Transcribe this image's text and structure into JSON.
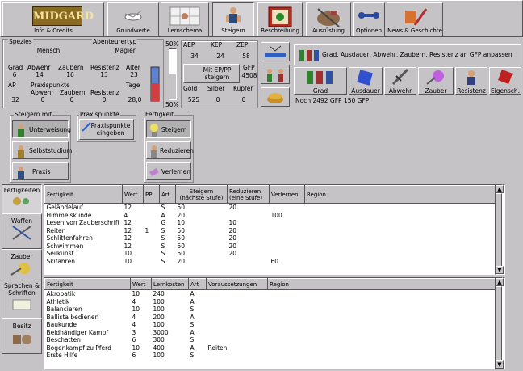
{
  "toolbar": {
    "logo": "MIDGARD",
    "tabs": [
      {
        "label": "Info & Credits"
      },
      {
        "label": "Grundwerte"
      },
      {
        "label": "Lernschema"
      },
      {
        "label": "Steigern"
      },
      {
        "label": "Beschreibung"
      },
      {
        "label": "Ausrüstung"
      },
      {
        "label": "Optionen"
      },
      {
        "label": "News & Geschichte"
      }
    ]
  },
  "character": {
    "spezies_label": "Spezies",
    "spezies": "Mensch",
    "abenteurertyp_label": "Abenteurertyp",
    "abenteurertyp": "Magier",
    "grad_label": "Grad",
    "grad": "6",
    "abwehr_label": "Abwehr",
    "abwehr": "14",
    "zaubern_label": "Zaubern",
    "zaubern": "16",
    "resistenz_label": "Resistenz",
    "resistenz": "13",
    "alter_label": "Alter",
    "alter": "23",
    "ap_label": "AP",
    "ap": "32",
    "praxispunkte_label": "Praxispunkte",
    "pp_abwehr_label": "Abwehr",
    "pp_abwehr": "0",
    "pp_zaubern_label": "Zaubern",
    "pp_zaubern": "0",
    "pp_resistenz_label": "Resistenz",
    "pp_resistenz": "0",
    "tage_label": "Tage",
    "tage": "28,0"
  },
  "progress": {
    "top_label": "50%",
    "bottom_label": "50%"
  },
  "points": {
    "aep_label": "AEP",
    "aep": "34",
    "kep_label": "KEP",
    "kep": "24",
    "zep_label": "ZEP",
    "zep": "58",
    "gfp_label": "GFP",
    "gfp": "4508",
    "gold_label": "Gold",
    "gold": "525",
    "silber_label": "Silber",
    "silber": "0",
    "kupfer_label": "Kupfer",
    "kupfer": "0",
    "mit_ep_button": "Mit EP/PP steigern"
  },
  "anpassen_button": "Grad, Ausdauer, Abwehr, Zaubern, Resistenz an GFP anpassen",
  "steigern_icons": [
    {
      "label": "Grad"
    },
    {
      "label": "Ausdauer"
    },
    {
      "label": "Abwehr"
    },
    {
      "label": "Zauber"
    },
    {
      "label": "Resistenz"
    },
    {
      "label": "Eigensch."
    }
  ],
  "gfp_note": "Noch 2492 GFP    150 GFP",
  "steigern_mit": {
    "title": "Steigern mit",
    "options": [
      {
        "label": "Unterweisung"
      },
      {
        "label": "Selbststudium"
      },
      {
        "label": "Praxis"
      }
    ]
  },
  "praxispunkte_box": {
    "title": "Praxispunkte",
    "button": "Praxispunkte eingeben"
  },
  "fertigkeit_box": {
    "title": "Fertigkeit",
    "options": [
      {
        "label": "Steigern"
      },
      {
        "label": "Reduzieren"
      },
      {
        "label": "Verlernen"
      }
    ]
  },
  "sidebar": [
    {
      "label": "Fertigkeiten"
    },
    {
      "label": "Waffen"
    },
    {
      "label": "Zauber"
    },
    {
      "label": "Sprachen & Schriften"
    },
    {
      "label": "Besitz"
    }
  ],
  "upper_table": {
    "headers": [
      "Fertigkeit",
      "Wert",
      "PP",
      "Art",
      "Steigern (nächste Stufe)",
      "Reduzieren (eine Stufe)",
      "Verlernen",
      "Region"
    ],
    "rows": [
      [
        "Geländelauf",
        "12",
        "",
        "S",
        "50",
        "20",
        "",
        ""
      ],
      [
        "Himmelskunde",
        "4",
        "",
        "A",
        "20",
        "",
        "100",
        ""
      ],
      [
        "Lesen von Zauberschrift",
        "12",
        "",
        "G",
        "10",
        "10",
        "",
        ""
      ],
      [
        "Reiten",
        "12",
        "1",
        "S",
        "50",
        "20",
        "",
        ""
      ],
      [
        "Schlittenfahren",
        "12",
        "",
        "S",
        "50",
        "20",
        "",
        ""
      ],
      [
        "Schwimmen",
        "12",
        "",
        "S",
        "50",
        "20",
        "",
        ""
      ],
      [
        "Seilkunst",
        "10",
        "",
        "S",
        "50",
        "20",
        "",
        ""
      ],
      [
        "Skifahren",
        "10",
        "",
        "S",
        "20",
        "",
        "60",
        ""
      ]
    ]
  },
  "lower_table": {
    "headers": [
      "Fertigkeit",
      "Wert",
      "Lernkosten",
      "Art",
      "Voraussetzungen",
      "Region"
    ],
    "rows": [
      [
        "Akrobatik",
        "10",
        "240",
        "A",
        "",
        ""
      ],
      [
        "Athletik",
        "4",
        "100",
        "A",
        "",
        ""
      ],
      [
        "Balancieren",
        "10",
        "100",
        "S",
        "",
        ""
      ],
      [
        "Ballista bedienen",
        "4",
        "200",
        "A",
        "",
        ""
      ],
      [
        "Baukunde",
        "4",
        "100",
        "S",
        "",
        ""
      ],
      [
        "Beidhändiger Kampf",
        "3",
        "3000",
        "A",
        "",
        ""
      ],
      [
        "Beschatten",
        "6",
        "300",
        "S",
        "",
        ""
      ],
      [
        "Bogenkampf zu Pferd",
        "10",
        "400",
        "A",
        "Reiten",
        ""
      ],
      [
        "Erste Hilfe",
        "6",
        "100",
        "S",
        "",
        ""
      ]
    ]
  }
}
